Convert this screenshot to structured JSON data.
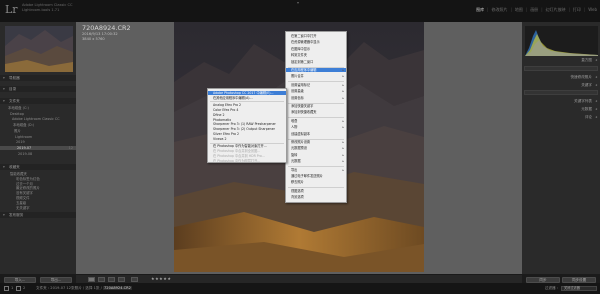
{
  "app": {
    "logo": "Lr",
    "catalog_line1": "Adobe Lightroom Classic CC",
    "catalog_line2": "Lightroom-tools 1.71"
  },
  "modules": [
    "图库",
    "修改照片",
    "地图",
    "画册",
    "幻灯片放映",
    "打印",
    "Web"
  ],
  "active_module": "图库",
  "left_panel": {
    "navigator": "导航器",
    "catalog": "目录",
    "folders": "文件夹",
    "folder_items": [
      {
        "label": "本地磁盘 (C:)",
        "count": "",
        "selected": false
      },
      {
        "label": "Desktop",
        "count": "",
        "selected": false
      },
      {
        "label": "Adobe Lightroom Classic CC",
        "count": "",
        "selected": false
      },
      {
        "label": "本地磁盘 (D:)",
        "count": "",
        "selected": false
      },
      {
        "label": "照片",
        "count": "",
        "selected": false
      },
      {
        "label": "Lightroom",
        "count": "",
        "selected": false
      },
      {
        "label": "2019",
        "count": "",
        "selected": false
      },
      {
        "label": "2019-07",
        "count": "12",
        "selected": true
      },
      {
        "label": "2019-08",
        "count": "",
        "selected": false
      }
    ],
    "collections": "收藏夹",
    "collection_items": [
      {
        "label": "智能收藏夹",
        "count": ""
      },
      {
        "label": "彩色标签为红色",
        "count": ""
      },
      {
        "label": "过去一个月",
        "count": ""
      },
      {
        "label": "最近修改的照片",
        "count": ""
      },
      {
        "label": "没有关键字",
        "count": ""
      },
      {
        "label": "视频文件",
        "count": ""
      },
      {
        "label": "五星级",
        "count": ""
      },
      {
        "label": "无关键字",
        "count": ""
      }
    ],
    "publish": "发布服务",
    "import_button": "导入...",
    "export_button": "导出..."
  },
  "photo_info": {
    "filename": "720A8924.CR2",
    "line1": "2016/9/13 17:00:32",
    "line2": "3840 x 5760"
  },
  "context_menu_main": {
    "items": [
      {
        "label": "在第二窗口中打开",
        "type": "item"
      },
      {
        "label": "在资源管理器中显示",
        "type": "item"
      },
      {
        "label": "在图库中显示",
        "type": "item"
      },
      {
        "label": "转到文件夹",
        "type": "item"
      },
      {
        "label": "锁定到第二窗口",
        "type": "item"
      },
      {
        "label": "在应用程序中编辑",
        "type": "submenu",
        "highlight": true
      },
      {
        "label": "照片合并",
        "type": "submenu"
      },
      {
        "label": "设置留用标记",
        "type": "submenu"
      },
      {
        "label": "设置星级",
        "type": "submenu"
      },
      {
        "label": "设置色标",
        "type": "submenu"
      },
      {
        "label": "添加快捷关键字",
        "type": "item"
      },
      {
        "label": "添加到快捷收藏夹",
        "type": "item"
      },
      {
        "label": "堆叠",
        "type": "submenu"
      },
      {
        "label": "人物",
        "type": "submenu"
      },
      {
        "label": "创建虚拟副本",
        "type": "item"
      },
      {
        "label": "修改照片设置",
        "type": "submenu"
      },
      {
        "label": "元数据预设",
        "type": "submenu"
      },
      {
        "label": "旋转",
        "type": "submenu"
      },
      {
        "label": "元数据",
        "type": "submenu"
      },
      {
        "label": "导出",
        "type": "submenu"
      },
      {
        "label": "通过电子邮件发送照片",
        "type": "item"
      },
      {
        "label": "移去照片",
        "type": "item"
      },
      {
        "label": "视图选项",
        "type": "item"
      },
      {
        "label": "背景选项",
        "type": "item"
      }
    ]
  },
  "context_menu_sub": {
    "items": [
      {
        "label": "Adobe Photoshop CC 2017 中编辑(E)...",
        "type": "item",
        "highlight": true
      },
      {
        "label": "在其他应用程序中编辑(A)...",
        "type": "item"
      },
      {
        "label": "Analog Efex Pro 2",
        "type": "item"
      },
      {
        "label": "Color Efex Pro 4",
        "type": "item"
      },
      {
        "label": "Dfine 2",
        "type": "item"
      },
      {
        "label": "Photomatix",
        "type": "item"
      },
      {
        "label": "Sharpener Pro 3: (1) RAW Presharpener",
        "type": "item"
      },
      {
        "label": "Sharpener Pro 3: (2) Output Sharpener",
        "type": "item"
      },
      {
        "label": "Silver Efex Pro 2",
        "type": "item"
      },
      {
        "label": "Viveza 2",
        "type": "item"
      },
      {
        "label": "在 Photoshop 中作为智能对象打开...",
        "type": "item"
      },
      {
        "label": "在 Photoshop 中合并到全景图...",
        "type": "disabled"
      },
      {
        "label": "在 Photoshop 中合并到 HDR Pro...",
        "type": "disabled"
      },
      {
        "label": "在 Photoshop 中作为图层打开...",
        "type": "disabled"
      }
    ]
  },
  "right_panel": {
    "histogram": "直方图",
    "quick_develop": "快速修改照片",
    "keywording": "关键字",
    "keyword_list": "关键字列表",
    "metadata": "元数据",
    "comments": "评论",
    "sync_button": "同步",
    "sync_settings_button": "同步设置"
  },
  "toolbar": {
    "stars": "★★★★★"
  },
  "bottombar": {
    "page_1": "1",
    "page_2": "2",
    "path_prefix": "文件夹 : 2019-07   12张照片 / 选择 1张 /",
    "path_file": "720A8924.CR2",
    "filter_label": "过滤器 :",
    "filter_value": "关闭过滤器"
  },
  "colors": {
    "menu_highlight": "#3d7ed6",
    "panel_bg": "#2a2a2a",
    "center_bg": "#5f5f5f"
  }
}
